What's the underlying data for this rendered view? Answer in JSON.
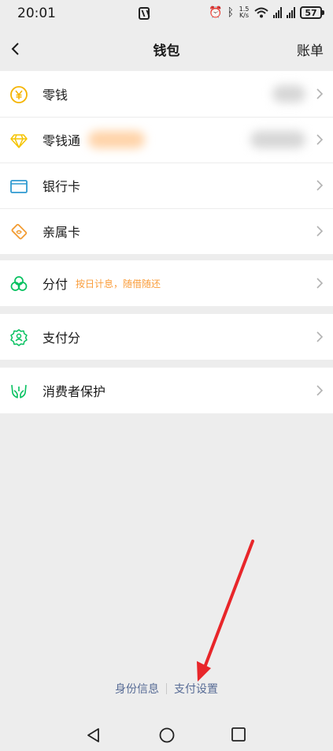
{
  "status": {
    "time": "20:01",
    "speed_top": "1.5",
    "speed_unit": "K/s",
    "battery": "57"
  },
  "nav": {
    "title": "钱包",
    "right_label": "账单"
  },
  "wallet_items": [
    {
      "label": "零钱"
    },
    {
      "label": "零钱通"
    },
    {
      "label": "银行卡"
    },
    {
      "label": "亲属卡"
    }
  ],
  "credit_items": [
    {
      "label": "分付",
      "sub": "按日计息，随借随还"
    }
  ],
  "score_items": [
    {
      "label": "支付分"
    }
  ],
  "protect_items": [
    {
      "label": "消费者保护"
    }
  ],
  "footer": {
    "identity_label": "身份信息",
    "settings_label": "支付设置"
  },
  "colors": {
    "accent_green": "#07c160",
    "link_blue": "#576b95",
    "orange": "#fa9d3b",
    "annotation_red": "#e8262a"
  }
}
